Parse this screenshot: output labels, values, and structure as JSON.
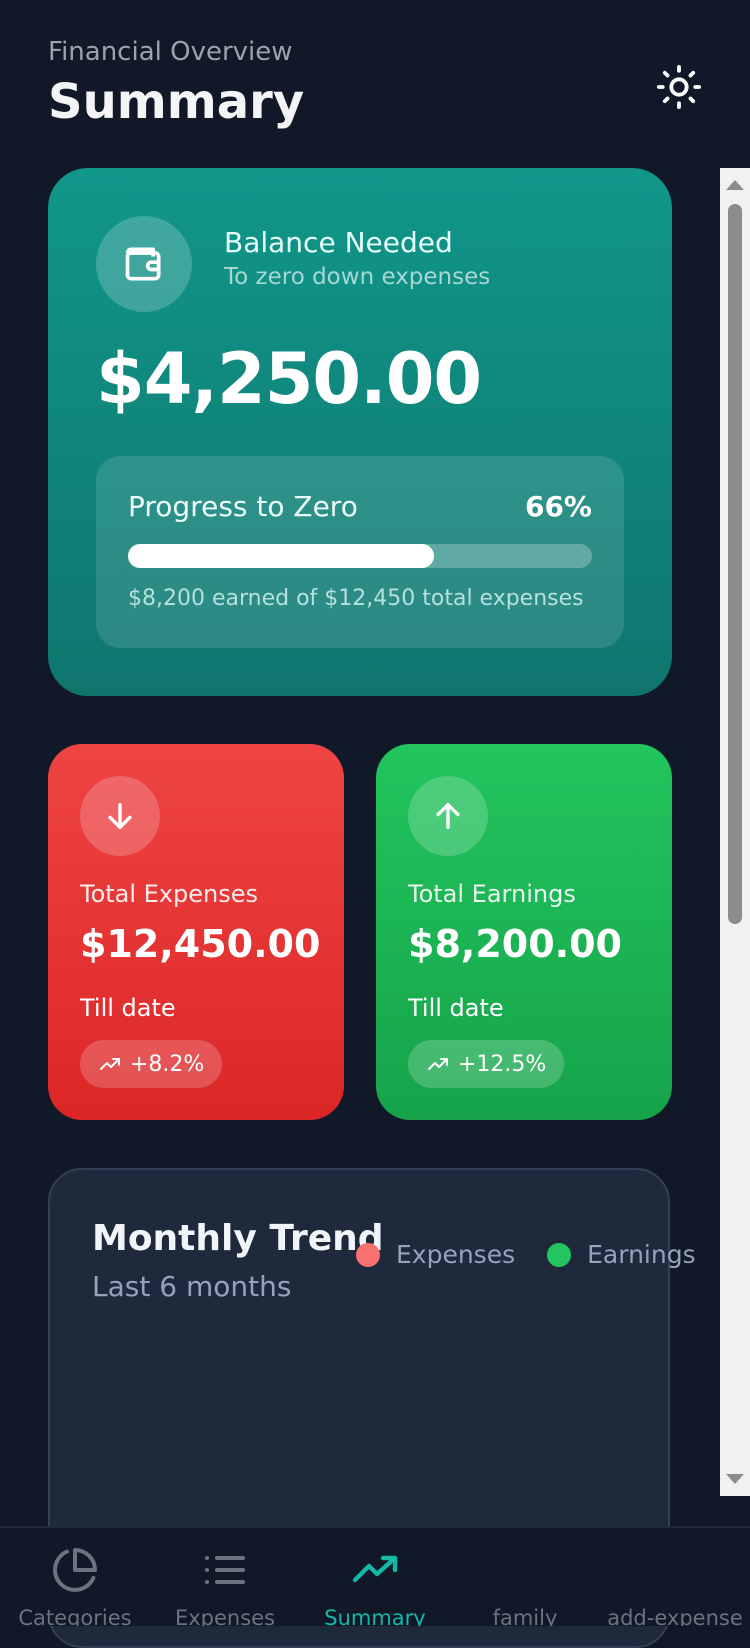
{
  "header": {
    "subtitle": "Financial Overview",
    "title": "Summary",
    "theme_icon": "sun-icon"
  },
  "balance": {
    "label": "Balance Needed",
    "sublabel": "To zero down expenses",
    "amount": "$4,250.00",
    "progress_label": "Progress to Zero",
    "progress_percent": "66%",
    "progress_value": 0.66,
    "progress_note": "$8,200 earned of $12,450 total expenses",
    "icon": "wallet-icon"
  },
  "expenses": {
    "label": "Total Expenses",
    "amount": "$12,450.00",
    "till": "Till date",
    "change": "+8.2%",
    "icon": "arrow-down-icon",
    "color": "#ef4444"
  },
  "earnings": {
    "label": "Total Earnings",
    "amount": "$8,200.00",
    "till": "Till date",
    "change": "+12.5%",
    "icon": "arrow-up-icon",
    "color": "#22c55e"
  },
  "trend": {
    "title": "Monthly Trend",
    "subtitle": "Last 6 months",
    "legend": [
      {
        "label": "Expenses",
        "color": "#f87171"
      },
      {
        "label": "Earnings",
        "color": "#22c55e"
      }
    ]
  },
  "nav": {
    "items": [
      {
        "label": "Categories",
        "icon": "pie-chart-icon",
        "active": false
      },
      {
        "label": "Expenses",
        "icon": "list-icon",
        "active": false
      },
      {
        "label": "Summary",
        "icon": "trending-up-icon",
        "active": true
      },
      {
        "label": "family",
        "icon": "",
        "active": false
      },
      {
        "label": "add-expense",
        "icon": "",
        "active": false
      }
    ],
    "active_color": "#14b8a6"
  }
}
